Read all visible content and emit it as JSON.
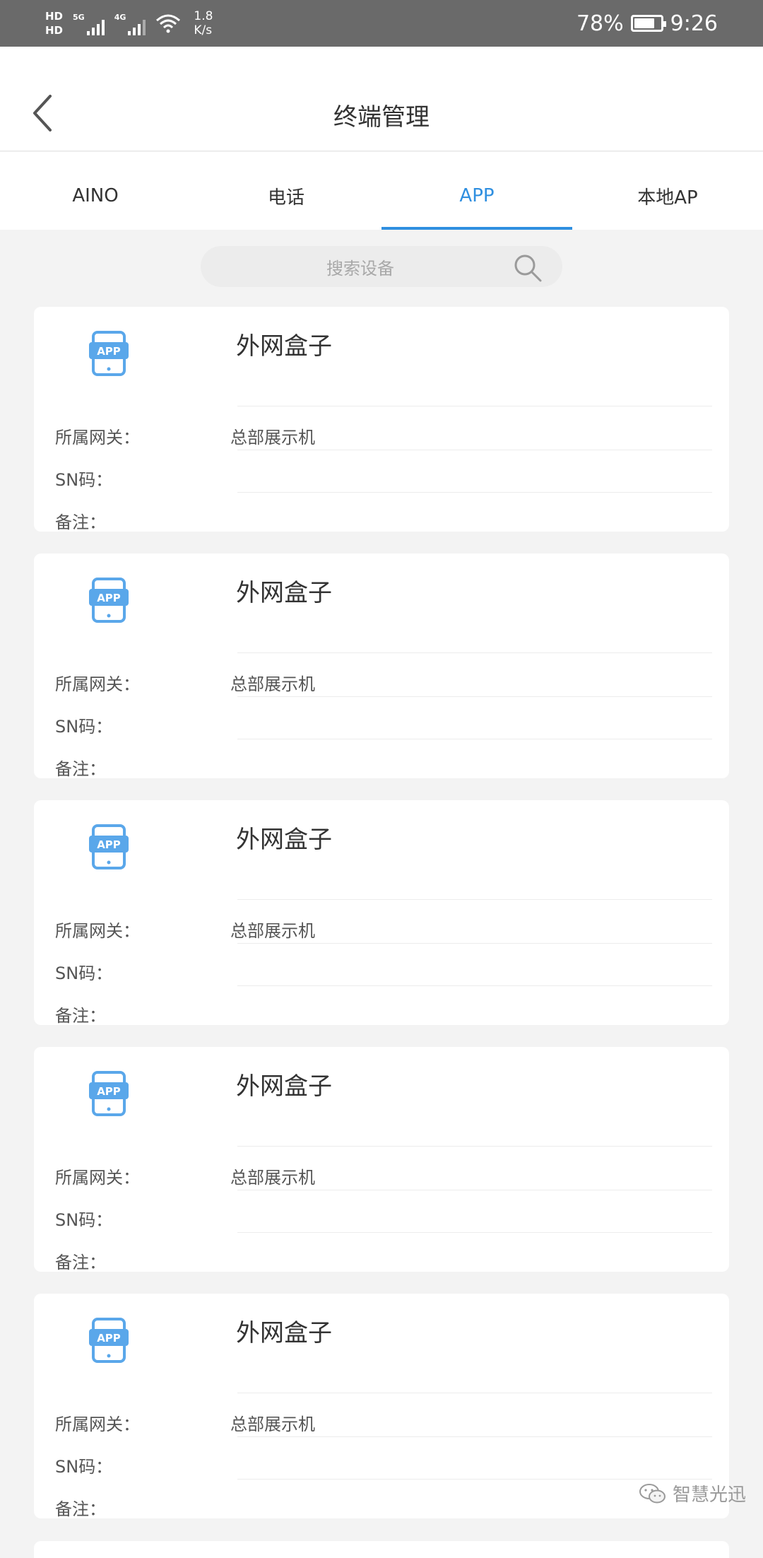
{
  "status_bar": {
    "hd1": "HD",
    "hd2": "HD",
    "net1": "5G",
    "net2": "4G",
    "speed_value": "1.8",
    "speed_unit": "K/s",
    "battery": "78%",
    "battery_level": 0.78,
    "time": "9:26"
  },
  "header": {
    "title": "终端管理"
  },
  "tabs": [
    {
      "label": "AINO"
    },
    {
      "label": "电话"
    },
    {
      "label": "APP"
    },
    {
      "label": "本地AP"
    }
  ],
  "search": {
    "placeholder": "搜索设备"
  },
  "labels": {
    "gateway": "所属网关：",
    "sn": "SN码：",
    "note": "备注："
  },
  "devices": [
    {
      "icon_text": "APP",
      "name": "外网盒子",
      "gateway": "总部展示机",
      "sn": "",
      "note": ""
    },
    {
      "icon_text": "APP",
      "name": "外网盒子",
      "gateway": "总部展示机",
      "sn": "",
      "note": ""
    },
    {
      "icon_text": "APP",
      "name": "外网盒子",
      "gateway": "总部展示机",
      "sn": "",
      "note": ""
    },
    {
      "icon_text": "APP",
      "name": "外网盒子",
      "gateway": "总部展示机",
      "sn": "",
      "note": ""
    },
    {
      "icon_text": "APP",
      "name": "外网盒子",
      "gateway": "总部展示机",
      "sn": "",
      "note": ""
    }
  ],
  "watermark": {
    "text": "智慧光迅"
  },
  "colors": {
    "accent": "#2f8fe0",
    "icon_blue": "#5aa7ea"
  }
}
